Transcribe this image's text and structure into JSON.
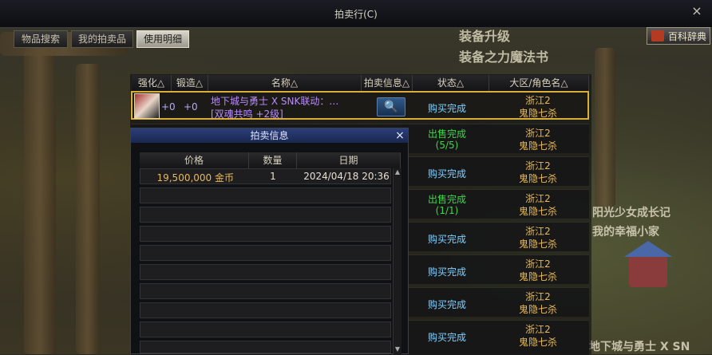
{
  "window": {
    "title": "拍卖行(C)",
    "close_icon": "×"
  },
  "tabs": [
    {
      "label": "物品搜索",
      "active": false
    },
    {
      "label": "我的拍卖品",
      "active": false
    },
    {
      "label": "使用明细",
      "active": true
    }
  ],
  "encyclopedia_button": {
    "label": "百科辞典",
    "icon": "book-icon"
  },
  "background_text": {
    "promo_line1": "装备升级",
    "promo_line2": "装备之力魔法书",
    "promo_line3": "阳光少女成长记",
    "promo_line4": "我的幸福小家",
    "promo_line5": "地下城与勇士 X SN"
  },
  "columns": [
    "强化△",
    "锻造△",
    "名称△",
    "拍卖信息△",
    "状态△",
    "大区/角色名△"
  ],
  "rows": [
    {
      "enhance": "+0",
      "forge": "+0",
      "name": "地下城与勇士 X SNK联动：…",
      "sub": "[双魂共鸣 +2级]",
      "status": "购买完成",
      "status_type": "buy",
      "region": "浙江2",
      "character": "鬼隐七杀",
      "selected": true
    },
    {
      "status": "出售完成",
      "status_count": "(5/5)",
      "status_type": "sell",
      "region": "浙江2",
      "character": "鬼隐七杀"
    },
    {
      "status": "购买完成",
      "status_type": "buy",
      "region": "浙江2",
      "character": "鬼隐七杀"
    },
    {
      "status": "出售完成",
      "status_count": "(1/1)",
      "status_type": "sell",
      "region": "浙江2",
      "character": "鬼隐七杀"
    },
    {
      "status": "购买完成",
      "status_type": "buy",
      "region": "浙江2",
      "character": "鬼隐七杀"
    },
    {
      "status": "购买完成",
      "status_type": "buy",
      "region": "浙江2",
      "character": "鬼隐七杀"
    },
    {
      "status": "购买完成",
      "status_type": "buy",
      "region": "浙江2",
      "character": "鬼隐七杀"
    },
    {
      "status": "购买完成",
      "status_type": "buy",
      "region": "浙江2",
      "character": "鬼隐七杀"
    }
  ],
  "popup": {
    "title": "拍卖信息",
    "close_icon": "×",
    "columns": [
      "价格",
      "数量",
      "日期"
    ],
    "entries": [
      {
        "price": "19,500,000 金币",
        "qty": "1",
        "date": "2024/04/18 20:36"
      }
    ]
  },
  "colors": {
    "status_buy": "#7fd0ff",
    "status_sell": "#3fd64a",
    "region": "#e8b957",
    "item_name": "#b98cff",
    "selected_border": "#d8ae3a"
  }
}
